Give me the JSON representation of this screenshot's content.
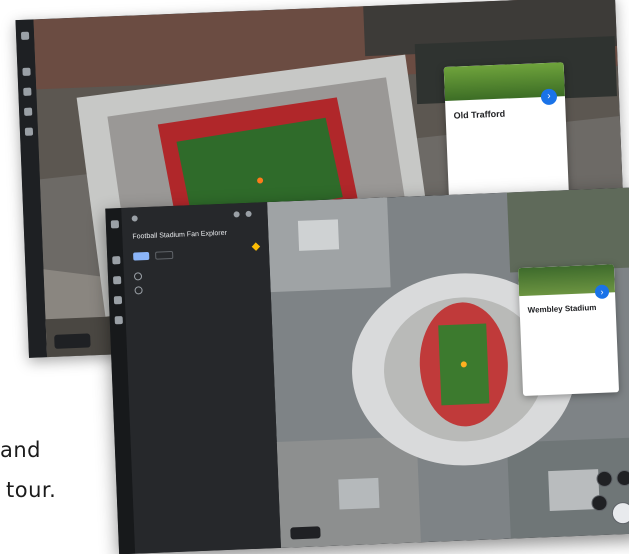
{
  "back_window": {
    "info_card": {
      "title": "Old Trafford",
      "subtitle": "",
      "description": "",
      "link": "",
      "fab_icon": "chevron-icon"
    }
  },
  "front_window": {
    "side_panel": {
      "breadcrumb": "",
      "title": "Football Stadium Fan Explorer",
      "subtitle": "",
      "primary_button": "",
      "secondary_button": "",
      "items": [
        {
          "label": "",
          "icon": "location-icon"
        },
        {
          "label": "",
          "icon": "location-icon"
        }
      ],
      "footer": ""
    },
    "info_card": {
      "title": "Wembley Stadium",
      "subtitle": "",
      "description": "",
      "link": "",
      "fab_icon": "chevron-icon"
    }
  },
  "caption": {
    "line1": "and",
    "line2": "tour."
  },
  "colors": {
    "accent": "#1a73e8",
    "panel_dark": "#26282b",
    "pitch_green": "#2f6b2a",
    "seats_red": "#b0272a"
  }
}
